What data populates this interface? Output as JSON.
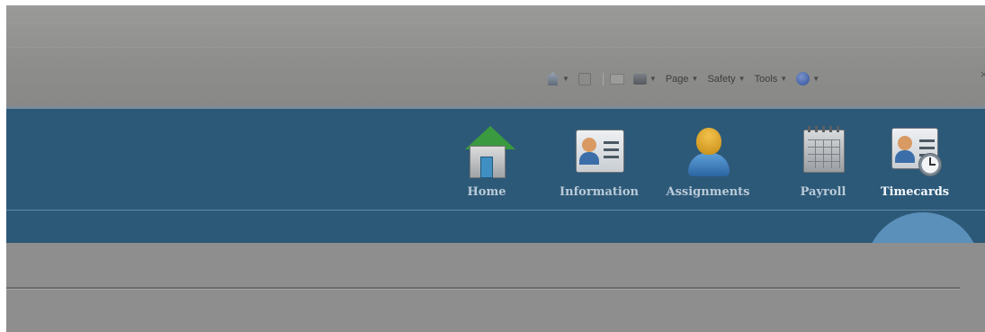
{
  "command_bar": {
    "items": [
      {
        "icon": "home-icon",
        "label": ""
      },
      {
        "icon": "feeds-icon",
        "label": ""
      },
      {
        "icon": "read-mail-icon",
        "label": ""
      },
      {
        "icon": "print-icon",
        "label": ""
      },
      {
        "icon": "page-menu",
        "label": "Page"
      },
      {
        "icon": "safety-menu",
        "label": "Safety"
      },
      {
        "icon": "tools-menu",
        "label": "Tools"
      },
      {
        "icon": "help-icon",
        "label": ""
      }
    ],
    "close_glyph": "×"
  },
  "nav": {
    "items": [
      {
        "label": "Home",
        "icon": "home-icon"
      },
      {
        "label": "Information",
        "icon": "id-card-icon"
      },
      {
        "label": "Assignments",
        "icon": "worker-icon"
      },
      {
        "label": "Payroll",
        "icon": "calendar-icon"
      },
      {
        "label": "Timecards",
        "icon": "timecard-icon"
      }
    ],
    "active": "Timecards",
    "colors": {
      "bar": "#2d5978",
      "highlight": "#82bef0"
    }
  }
}
